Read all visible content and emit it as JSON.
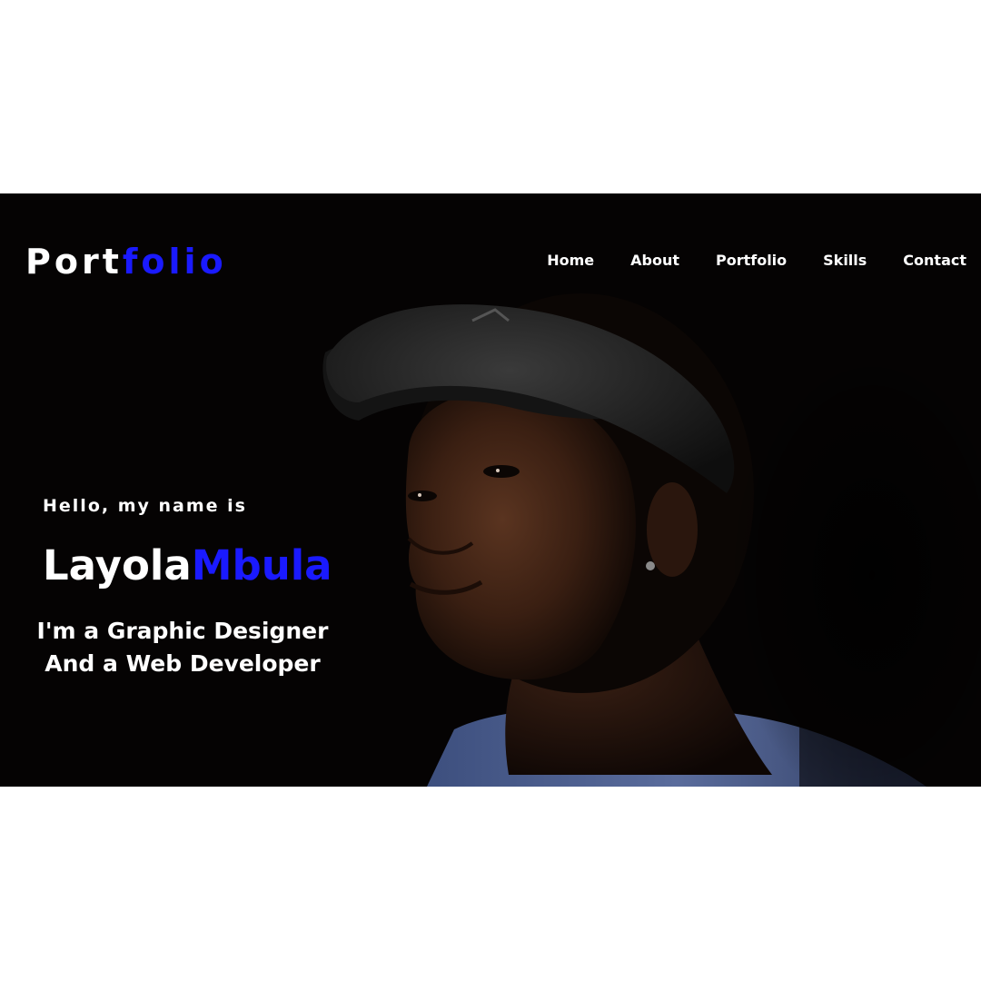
{
  "header": {
    "logo_part1": "Port",
    "logo_part2": "folio"
  },
  "nav": {
    "items": [
      "Home",
      "About",
      "Portfolio",
      "Skills",
      "Contact"
    ]
  },
  "hero": {
    "greeting": "Hello, my name is",
    "first_name": "Layola",
    "last_name": "Mbula",
    "tagline_line1": "I'm a Graphic Designer",
    "tagline_line2": "And a Web Developer",
    "photo_icon": "portrait-photo"
  },
  "colors": {
    "background": "#050303",
    "accent": "#1a1aff",
    "text": "#ffffff",
    "page": "#ffffff"
  }
}
